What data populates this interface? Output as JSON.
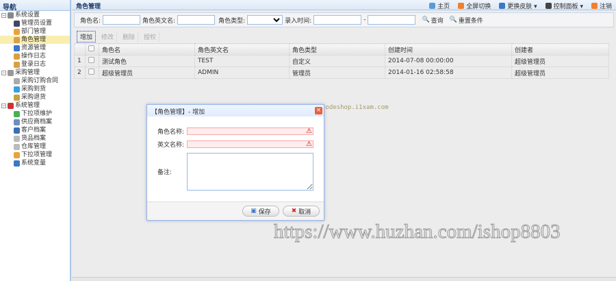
{
  "sidebar": {
    "title": "导航",
    "items": [
      {
        "label": "系统设置",
        "level": 0,
        "color": "#888"
      },
      {
        "label": "管理员设置",
        "level": 1,
        "color": "#446"
      },
      {
        "label": "部门管理",
        "level": 1,
        "color": "#e9a33a"
      },
      {
        "label": "角色管理",
        "level": 1,
        "color": "#d6a050",
        "selected": true
      },
      {
        "label": "资源管理",
        "level": 1,
        "color": "#3a78c8"
      },
      {
        "label": "操作日志",
        "level": 1,
        "color": "#d9a040"
      },
      {
        "label": "登录日志",
        "level": 1,
        "color": "#d9a040"
      },
      {
        "label": "采购管理",
        "level": 0,
        "color": "#999"
      },
      {
        "label": "采购订购合同",
        "level": 1,
        "color": "#aaa"
      },
      {
        "label": "采购到货",
        "level": 1,
        "color": "#39a0e0"
      },
      {
        "label": "采购退货",
        "level": 1,
        "color": "#c9a040"
      },
      {
        "label": "系统管理",
        "level": 0,
        "color": "#c33"
      },
      {
        "label": "下拉项维护",
        "level": 1,
        "color": "#4caf50"
      },
      {
        "label": "供应商档案",
        "level": 1,
        "color": "#6a8fc0"
      },
      {
        "label": "客户档案",
        "level": 1,
        "color": "#3b6fb3"
      },
      {
        "label": "货品档案",
        "level": 1,
        "color": "#bbb"
      },
      {
        "label": "仓库管理",
        "level": 1,
        "color": "#bbb"
      },
      {
        "label": "下拉项管理",
        "level": 1,
        "color": "#e9a33a"
      },
      {
        "label": "系统变量",
        "level": 1,
        "color": "#3a78c8"
      }
    ]
  },
  "header": {
    "title": "角色管理",
    "nav": [
      {
        "label": "主页",
        "color": "#5b9bd5"
      },
      {
        "label": "全屏切换",
        "color": "#f08030"
      },
      {
        "label": "更换皮肤 ▾",
        "color": "#3a78c8"
      },
      {
        "label": "控制面板 ▾",
        "color": "#444"
      },
      {
        "label": "注销",
        "color": "#f08030"
      }
    ]
  },
  "search": {
    "role_name": "角色名:",
    "role_en": "角色英文名:",
    "role_type": "角色类型:",
    "entry_time": "录入时间:",
    "dash": "-",
    "query": "查询",
    "reset": "重置条件"
  },
  "toolbar": {
    "add": "增加",
    "edit": "修改",
    "delete": "删除",
    "grant": "授权"
  },
  "grid": {
    "columns": [
      "角色名",
      "角色英文名",
      "角色类型",
      "创建时间",
      "创建者"
    ],
    "rows": [
      {
        "num": "1",
        "name": "测试角色",
        "en": "TEST",
        "type": "自定义",
        "time": "2014-07-08 00:00:00",
        "creator": "超级管理员"
      },
      {
        "num": "2",
        "name": "超级管理员",
        "en": "ADMIN",
        "type": "管理员",
        "time": "2014-01-16 02:58:58",
        "creator": "超级管理员"
      }
    ]
  },
  "dialog": {
    "title": "【角色管理】- 增加",
    "name_label": "角色名称:",
    "en_label": "英文名称:",
    "remark_label": "备注:",
    "save": "保存",
    "cancel": "取消"
  },
  "watermarks": {
    "small": "codeshop.i1xam.com",
    "large": "https://www.huzhan.com/ishop8803"
  }
}
